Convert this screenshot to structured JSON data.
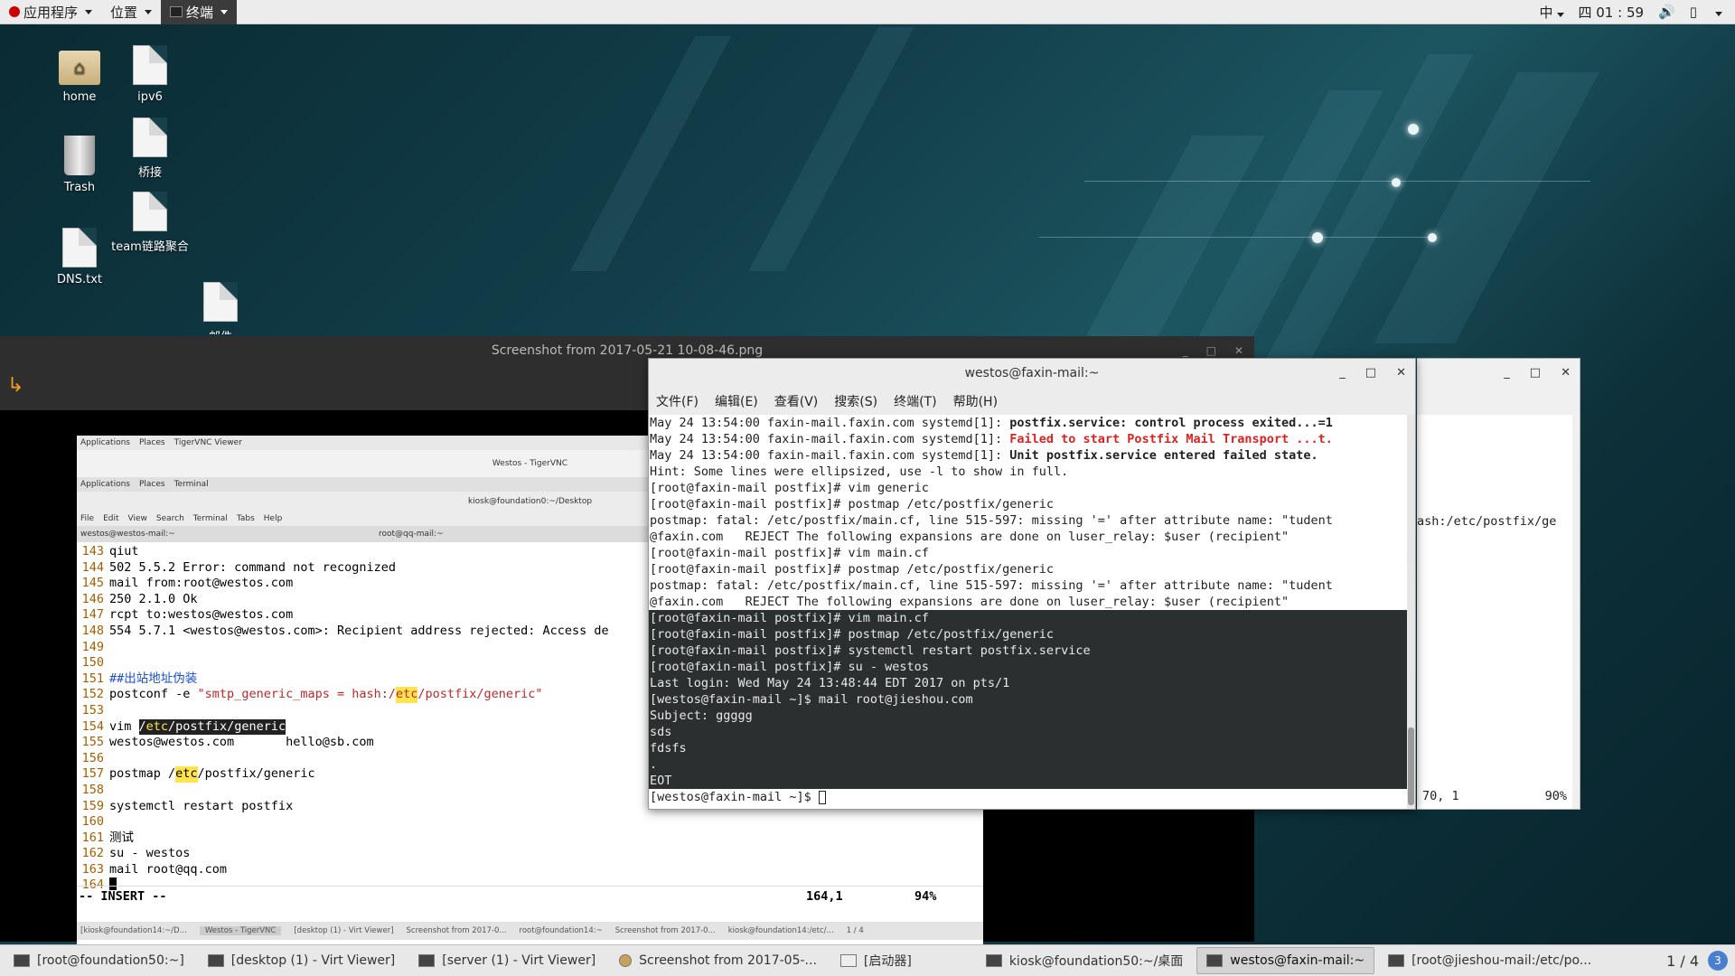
{
  "topbar": {
    "apps_label": "应用程序",
    "places_label": "位置",
    "active_app_label": "终端",
    "ime_label": "中",
    "clock": "四 01 : 59"
  },
  "desktop": {
    "icons": [
      {
        "label": "home"
      },
      {
        "label": "ipv6"
      },
      {
        "label": "Trash"
      },
      {
        "label": "桥接"
      },
      {
        "label": "team链路聚合"
      },
      {
        "label": "DNS.txt"
      },
      {
        "label": "邮件"
      }
    ]
  },
  "viewer": {
    "title": "Screenshot from 2017-05-21 10-08-46.png"
  },
  "vnc": {
    "topbar_apps": "Applications",
    "topbar_places": "Places",
    "topbar_app": "TigerVNC Viewer",
    "window_title": "Westos - TigerVNC",
    "inner_apps": "Applications",
    "inner_places": "Places",
    "inner_terminal": "Terminal",
    "term_title": "kiosk@foundation0:~/Desktop",
    "menu": [
      "File",
      "Edit",
      "View",
      "Search",
      "Terminal",
      "Tabs",
      "Help"
    ],
    "tabs": [
      "westos@westos-mail:~",
      "root@qq-mail:~"
    ],
    "status_mode": "-- INSERT --",
    "status_pos": "164,1",
    "status_pct": "94%",
    "taskbar": [
      "[kiosk@foundation14:~/D...",
      "Westos - TigerVNC",
      "[desktop (1) - Virt Viewer]",
      "Screenshot from 2017-0...",
      "root@foundation14:~",
      "Screenshot from 2017-0...",
      "kiosk@foundation14:/etc/...",
      "1 / 4"
    ]
  },
  "editor_lines": [
    {
      "n": "143",
      "t": "qiut"
    },
    {
      "n": "144",
      "t": "502 5.5.2 Error: command not recognized"
    },
    {
      "n": "145",
      "t": "mail from:root@westos.com"
    },
    {
      "n": "146",
      "t": "250 2.1.0 Ok"
    },
    {
      "n": "147",
      "t": "rcpt to:westos@westos.com"
    },
    {
      "n": "148",
      "t": "554 5.7.1 <westos@westos.com>: Recipient address rejected: Access de"
    },
    {
      "n": "149",
      "t": ""
    },
    {
      "n": "150",
      "t": ""
    },
    {
      "n": "151",
      "t": "##出站地址伪装"
    },
    {
      "n": "152",
      "a": "postconf -e ",
      "b": "\"smtp_generic_maps = hash:/",
      "c": "etc",
      "d": "/postfix/generic\""
    },
    {
      "n": "153",
      "t": ""
    },
    {
      "n": "154",
      "a": "vim ",
      "b": "/",
      "c": "etc",
      "d": "/postfix/generic"
    },
    {
      "n": "155",
      "t": "westos@westos.com       hello@sb.com"
    },
    {
      "n": "156",
      "t": ""
    },
    {
      "n": "157",
      "a": "postmap /",
      "c": "etc",
      "d": "/postfix/generic"
    },
    {
      "n": "158",
      "t": ""
    },
    {
      "n": "159",
      "t": "systemctl restart postfix"
    },
    {
      "n": "160",
      "t": ""
    },
    {
      "n": "161",
      "t": "测试"
    },
    {
      "n": "162",
      "t": "su - westos"
    },
    {
      "n": "163",
      "t": "mail root@qq.com"
    },
    {
      "n": "164",
      "t": ""
    }
  ],
  "terminal": {
    "title": "westos@faxin-mail:~",
    "menu": [
      "文件(F)",
      "编辑(E)",
      "查看(V)",
      "搜索(S)",
      "终端(T)",
      "帮助(H)"
    ],
    "lines_light": [
      {
        "a": "May 24 13:54:00 faxin-mail.faxin.com systemd[1]: ",
        "b": "postfix.service: control process exited...=1",
        "style": "bold"
      },
      {
        "a": "May 24 13:54:00 faxin-mail.faxin.com systemd[1]: ",
        "b": "Failed to start Postfix Mail Transport ...t.",
        "style": "red"
      },
      {
        "a": "May 24 13:54:00 faxin-mail.faxin.com systemd[1]: ",
        "b": "Unit postfix.service entered failed state.",
        "style": "bold"
      },
      {
        "a": "Hint: Some lines were ellipsized, use -l to show in full."
      },
      {
        "a": "[root@faxin-mail postfix]# vim generic"
      },
      {
        "a": "[root@faxin-mail postfix]# postmap /etc/postfix/generic"
      },
      {
        "a": "postmap: fatal: /etc/postfix/main.cf, line 515-597: missing '=' after attribute name: \"tudent"
      },
      {
        "a": "@faxin.com   REJECT The following expansions are done on luser_relay: $user (recipient\""
      },
      {
        "a": "[root@faxin-mail postfix]# vim main.cf"
      },
      {
        "a": "[root@faxin-mail postfix]# postmap /etc/postfix/generic"
      },
      {
        "a": "postmap: fatal: /etc/postfix/main.cf, line 515-597: missing '=' after attribute name: \"tudent"
      },
      {
        "a": "@faxin.com   REJECT The following expansions are done on luser_relay: $user (recipient\""
      }
    ],
    "lines_dark": [
      "[root@faxin-mail postfix]# vim main.cf",
      "[root@faxin-mail postfix]# postmap /etc/postfix/generic",
      "[root@faxin-mail postfix]# systemctl restart postfix.service",
      "[root@faxin-mail postfix]# su - westos",
      "Last login: Wed May 24 13:48:44 EDT 2017 on pts/1",
      "[westos@faxin-mail ~]$ mail root@jieshou.com",
      "Subject: ggggg",
      "sds",
      "fdsfs",
      ".",
      "EOT"
    ],
    "prompt": "[westos@faxin-mail ~]$ "
  },
  "back_window": {
    "line": "ash:/etc/postfix/ge",
    "pos": "70, 1",
    "pct": "90%"
  },
  "taskbar": {
    "items": [
      {
        "label": "[root@foundation50:~]"
      },
      {
        "label": "[desktop (1) - Virt Viewer]"
      },
      {
        "label": "[server (1) - Virt Viewer]"
      },
      {
        "label": "Screenshot from 2017-05-..."
      },
      {
        "label": "[启动器]"
      },
      {
        "label": "kiosk@foundation50:~/桌面"
      },
      {
        "label": "westos@faxin-mail:~"
      },
      {
        "label": "[root@jieshou-mail:/etc/po..."
      }
    ],
    "pager": "1 / 4",
    "badge": "3"
  }
}
